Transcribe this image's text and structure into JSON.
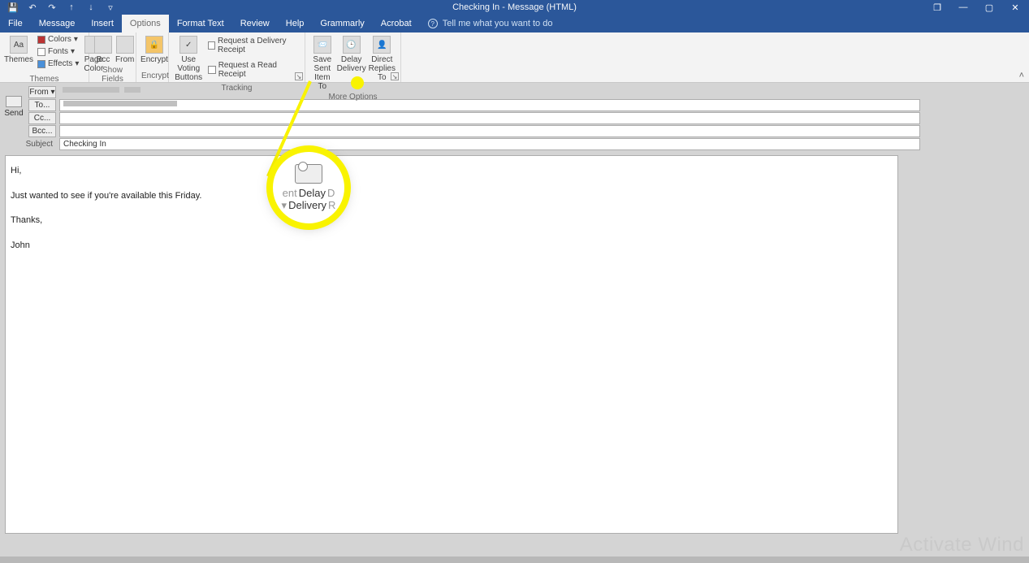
{
  "title": "Checking In  -  Message (HTML)",
  "qat": {
    "save": "save-icon",
    "undo": "undo-icon",
    "redo": "redo-icon",
    "up": "up-icon",
    "down": "down-icon",
    "more": "more-icon"
  },
  "win": {
    "pop": "❐",
    "min": "—",
    "max": "▢",
    "close": "✕"
  },
  "tabs": {
    "file": "File",
    "message": "Message",
    "insert": "Insert",
    "options": "Options",
    "format_text": "Format Text",
    "review": "Review",
    "help": "Help",
    "grammarly": "Grammarly",
    "acrobat": "Acrobat"
  },
  "tellme": {
    "placeholder": "Tell me what you want to do"
  },
  "ribbon": {
    "themes": {
      "label": "Themes",
      "themes_btn": "Themes",
      "colors": "Colors",
      "fonts": "Fonts",
      "effects": "Effects",
      "page_color": "Page\nColor"
    },
    "show_fields": {
      "label": "Show Fields",
      "bcc": "Bcc",
      "from": "From"
    },
    "encrypt": {
      "label": "Encrypt",
      "btn": "Encrypt"
    },
    "tracking": {
      "label": "Tracking",
      "voting": "Use Voting\nButtons",
      "delivery_receipt": "Request a Delivery Receipt",
      "read_receipt": "Request a Read Receipt"
    },
    "more_options": {
      "label": "More Options",
      "save_sent": "Save Sent\nItem To",
      "delay_delivery": "Delay\nDelivery",
      "direct_replies": "Direct\nReplies To"
    }
  },
  "compose": {
    "send": "Send",
    "from_btn": "From ▾",
    "to_btn": "To...",
    "cc_btn": "Cc...",
    "bcc_btn": "Bcc...",
    "subject_label": "Subject",
    "subject_value": "Checking In",
    "body": {
      "greeting": "Hi,",
      "line1": "Just wanted to see if you're available this Friday.",
      "signoff": "Thanks,",
      "name": "John"
    }
  },
  "callout": {
    "left": "ent",
    "main1": "Delay",
    "main2": "Delivery",
    "right": "D",
    "right2": "R"
  },
  "watermark": "Activate Wind"
}
